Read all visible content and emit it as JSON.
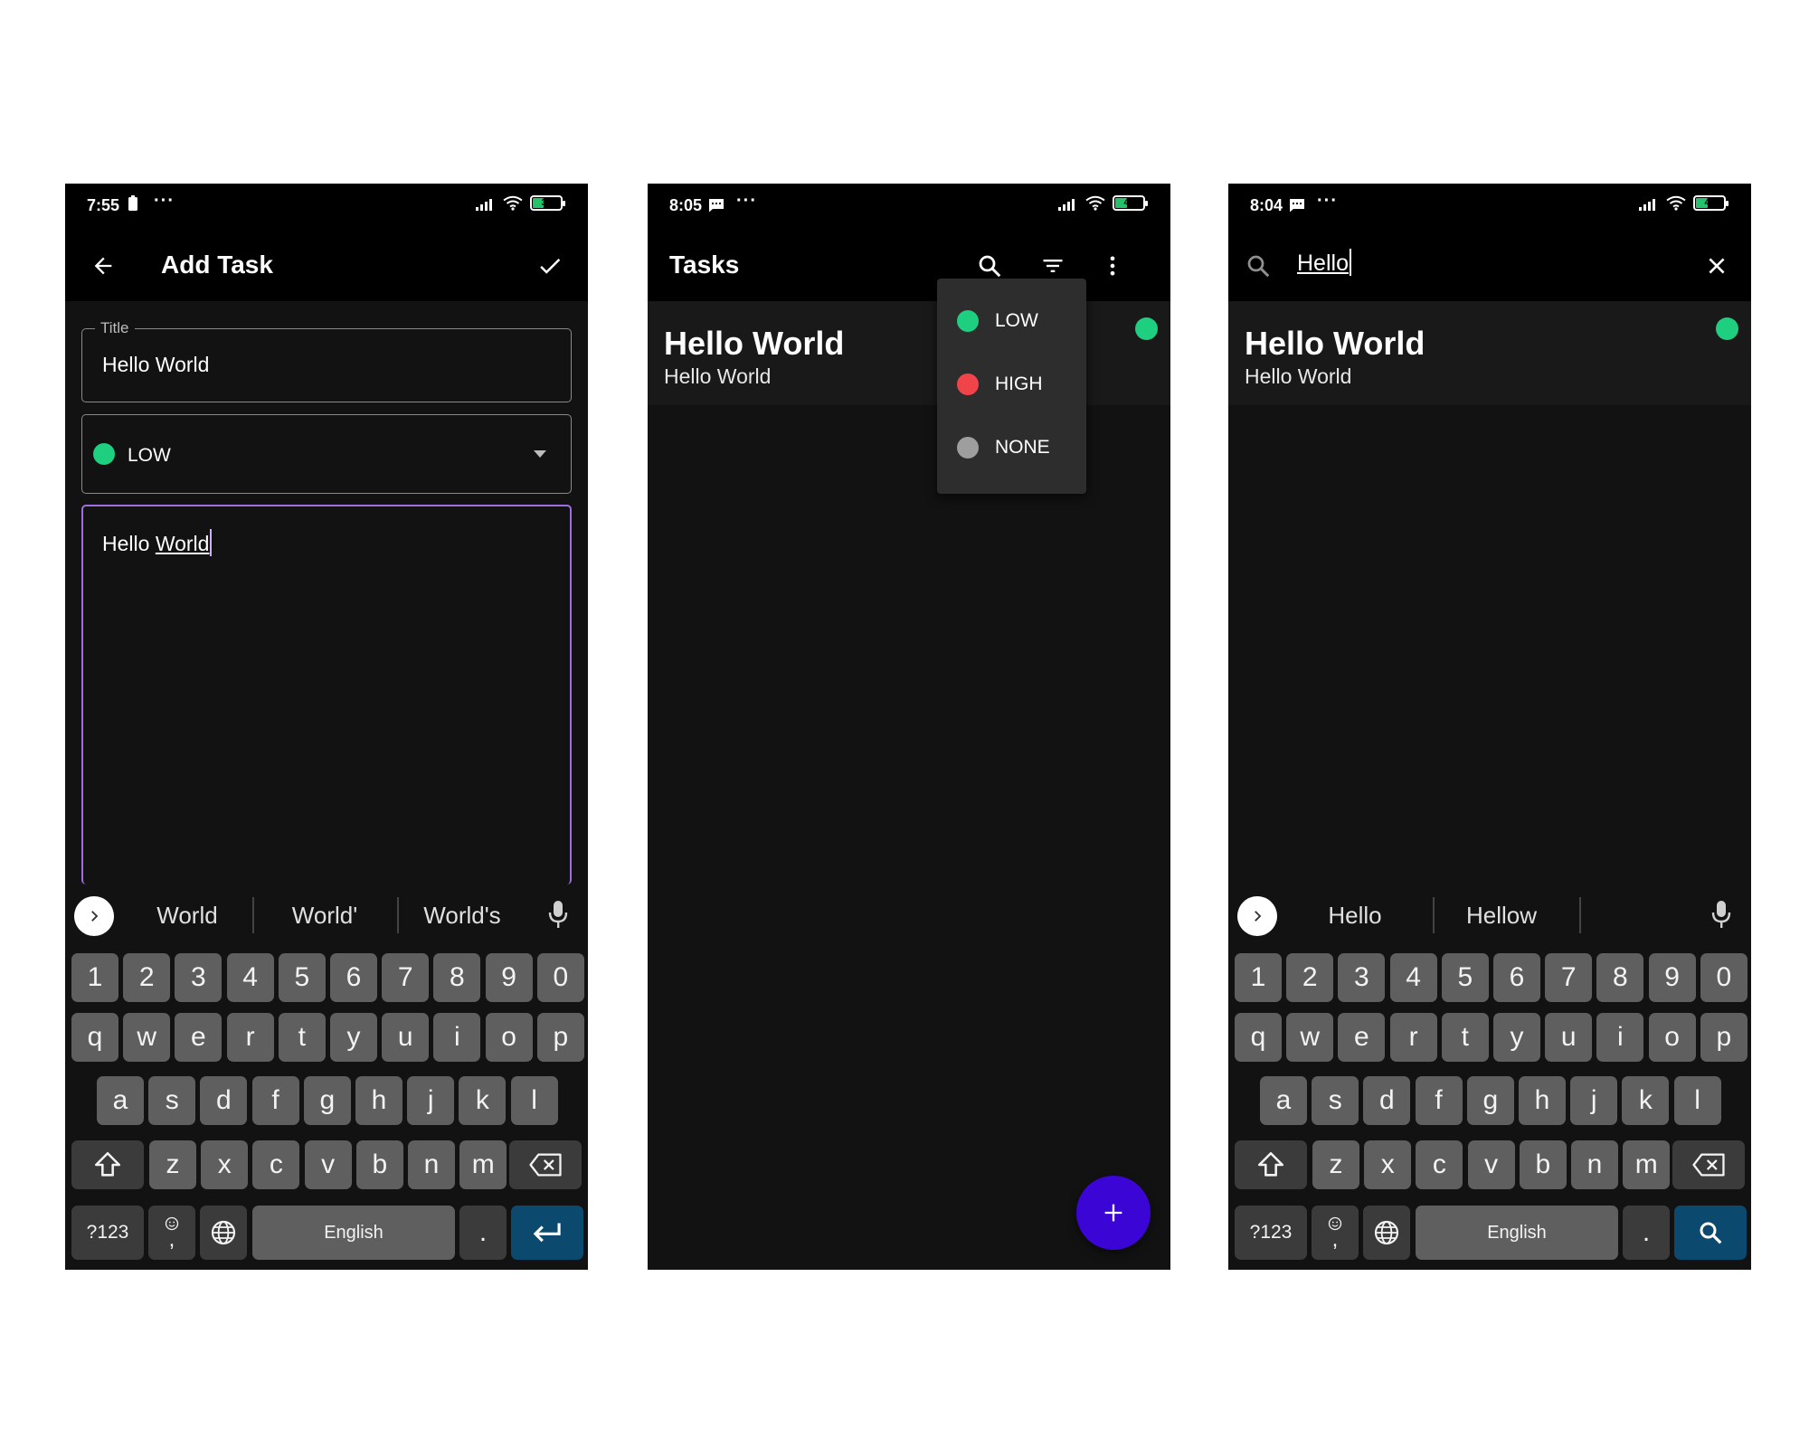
{
  "screens": [
    {
      "status": {
        "time": "7:55",
        "battery": "38"
      },
      "appbar": {
        "title": "Add Task"
      },
      "form": {
        "title_label": "Title",
        "title_value": "Hello World",
        "priority_value": "LOW",
        "description_plain": "Hello ",
        "description_underlined": "World"
      },
      "suggestions": [
        "World",
        "World'",
        "World's"
      ]
    },
    {
      "status": {
        "time": "8:05",
        "battery": "40"
      },
      "appbar": {
        "title": "Tasks"
      },
      "task": {
        "title": "Hello World",
        "description": "Hello World"
      },
      "menu": [
        {
          "label": "LOW",
          "color": "#1ecf7f"
        },
        {
          "label": "HIGH",
          "color": "#f0444a"
        },
        {
          "label": "NONE",
          "color": "#9e9e9e"
        }
      ]
    },
    {
      "status": {
        "time": "8:04",
        "battery": "40"
      },
      "search": {
        "value": "Hello"
      },
      "task": {
        "title": "Hello World",
        "description": "Hello World"
      },
      "suggestions": [
        "Hello",
        "Hellow"
      ]
    }
  ],
  "keyboard": {
    "row1": [
      "1",
      "2",
      "3",
      "4",
      "5",
      "6",
      "7",
      "8",
      "9",
      "0"
    ],
    "row2": [
      "q",
      "w",
      "e",
      "r",
      "t",
      "y",
      "u",
      "i",
      "o",
      "p"
    ],
    "row3": [
      "a",
      "s",
      "d",
      "f",
      "g",
      "h",
      "j",
      "k",
      "l"
    ],
    "row4": [
      "z",
      "x",
      "c",
      "v",
      "b",
      "n",
      "m"
    ],
    "symbols_label": "?123",
    "comma_label": ",",
    "period_label": ".",
    "space_label": "English"
  },
  "colors": {
    "low": "#1ecf7f",
    "high": "#f0444a",
    "none": "#9e9e9e",
    "accent": "#9f6fe0",
    "fab": "#3b05d6"
  },
  "icons": [
    "back-arrow-icon",
    "check-icon",
    "search-icon",
    "filter-icon",
    "more-vert-icon",
    "close-icon",
    "mic-icon",
    "chevron-right-icon",
    "shift-icon",
    "backspace-icon",
    "globe-icon",
    "enter-icon",
    "add-icon"
  ]
}
